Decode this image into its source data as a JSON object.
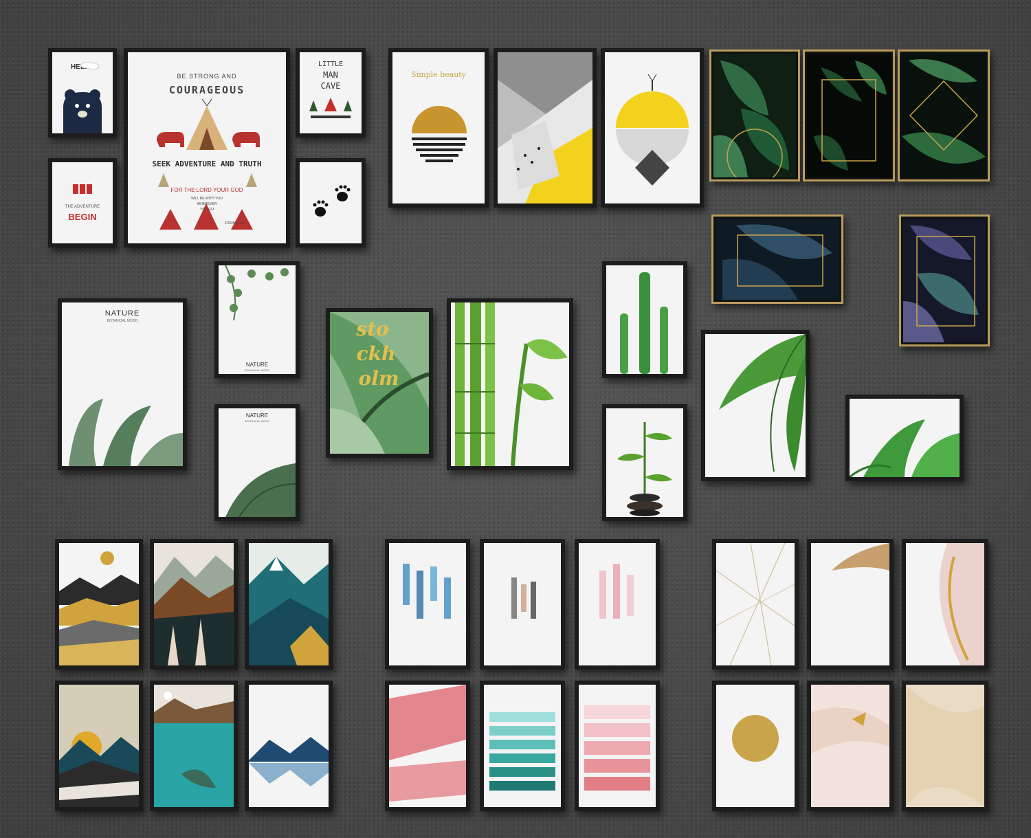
{
  "kids_posters": {
    "hello": {
      "text": "HELLO"
    },
    "adventure": {
      "line1": "BE STRONG AND",
      "line2": "COURAGEOUS",
      "line3": "SEEK ADVENTURE AND TRUTH",
      "line4": "FOR THE LORD YOUR GOD",
      "line5": "WILL BE WITH YOU",
      "line6": "WHEREVER",
      "line7": "YOU GO",
      "ref": "JOSHUA 1:9"
    },
    "man_cave": {
      "l1": "LITTLE",
      "l2": "MAN",
      "l3": "CAVE"
    },
    "begin": {
      "small": "THE ADVENTURE",
      "big": "BEGIN"
    }
  },
  "geometric": {
    "simple_beauty": "Simple beauty"
  },
  "botanical": {
    "nature_large": {
      "title": "NATURE",
      "sub": "BOTANICAL MOOD"
    },
    "nature_ivy": {
      "title": "NATURE",
      "sub": "BOTANICAL MOOD"
    },
    "nature_palm": {
      "title": "NATURE",
      "sub": "BOTANICAL MOOD"
    },
    "stockholm": {
      "l1": "sto",
      "l2": "ckh",
      "l3": "olm"
    }
  },
  "colors": {
    "frame": "#1c1c1c",
    "gold_frame": "#b89d5e",
    "accent_yellow": "#f2d21c",
    "accent_gold": "#d1a33c",
    "leaf_green": "#2f7d3c",
    "teal": "#1f6e78",
    "pink": "#e4868d"
  }
}
